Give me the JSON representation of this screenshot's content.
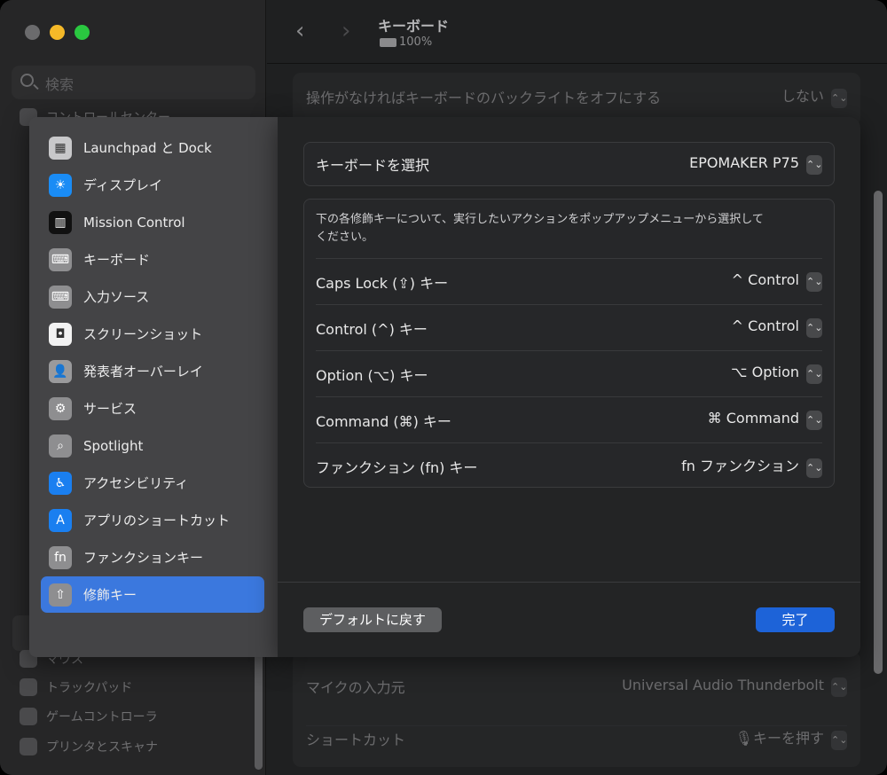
{
  "window": {
    "traffic_lights": [
      "#6b6b6d",
      "#f5b928",
      "#2ac840"
    ]
  },
  "sidebar": {
    "search_placeholder": "検索",
    "partial_item": "コントロールセンター",
    "items": [
      {
        "label": "マウス"
      },
      {
        "label": "トラックパッド"
      },
      {
        "label": "ゲームコントローラ"
      },
      {
        "label": "プリンタとスキャナ"
      }
    ]
  },
  "header": {
    "title": "キーボード",
    "battery": "100%",
    "back_icon": "‹",
    "forward_icon": "›"
  },
  "background": {
    "backlight_label": "操作がなければキーボードのバックライトをオフにする",
    "backlight_value": "しない",
    "mic_label": "マイクの入力元",
    "mic_value": "Universal Audio Thunderbolt",
    "shortcut_label": "ショートカット",
    "shortcut_value": "キーを押す"
  },
  "menu": {
    "items": [
      {
        "label": "Launchpad と Dock",
        "icon": "launchpad-icon",
        "color": "#c8c8ca"
      },
      {
        "label": "ディスプレイ",
        "icon": "sun-icon",
        "color": "#1a8cf5"
      },
      {
        "label": "Mission Control",
        "icon": "mission-control-icon",
        "color": "#111111"
      },
      {
        "label": "キーボード",
        "icon": "keyboard-icon",
        "color": "#8e8e90"
      },
      {
        "label": "入力ソース",
        "icon": "keyboard-icon",
        "color": "#8e8e90"
      },
      {
        "label": "スクリーンショット",
        "icon": "screenshot-icon",
        "color": "#f2f2f2"
      },
      {
        "label": "発表者オーバーレイ",
        "icon": "person-icon",
        "color": "#9a9a9c"
      },
      {
        "label": "サービス",
        "icon": "gears-icon",
        "color": "#8e8e90"
      },
      {
        "label": "Spotlight",
        "icon": "magnifier-icon",
        "color": "#8e8e90"
      },
      {
        "label": "アクセシビリティ",
        "icon": "accessibility-icon",
        "color": "#1a7ff0"
      },
      {
        "label": "アプリのショートカット",
        "icon": "app-store-icon",
        "color": "#1a7ff0"
      },
      {
        "label": "ファンクションキー",
        "icon": "fn-icon",
        "color": "#8e8e90"
      },
      {
        "label": "修飾キー",
        "icon": "modifier-arrow-icon",
        "color": "#8e8e90",
        "selected": true
      }
    ],
    "selected_color": "#3b78de"
  },
  "sheet": {
    "keyboard_select_label": "キーボードを選択",
    "keyboard_select_value": "EPOMAKER P75",
    "description": "下の各修飾キーについて、実行したいアクションをポップアップメニューから選択してください。",
    "rows": [
      {
        "label": "Caps Lock (⇪) キー",
        "value": "^ Control"
      },
      {
        "label": "Control (^) キー",
        "value": "^ Control"
      },
      {
        "label": "Option (⌥) キー",
        "value": "⌥ Option"
      },
      {
        "label": "Command (⌘) キー",
        "value": "⌘ Command"
      },
      {
        "label": "ファンクション (fn) キー",
        "value": "fn ファンクション"
      }
    ],
    "default_button": "デフォルトに戻す",
    "done_button": "完了",
    "done_color": "#1d63d8"
  }
}
